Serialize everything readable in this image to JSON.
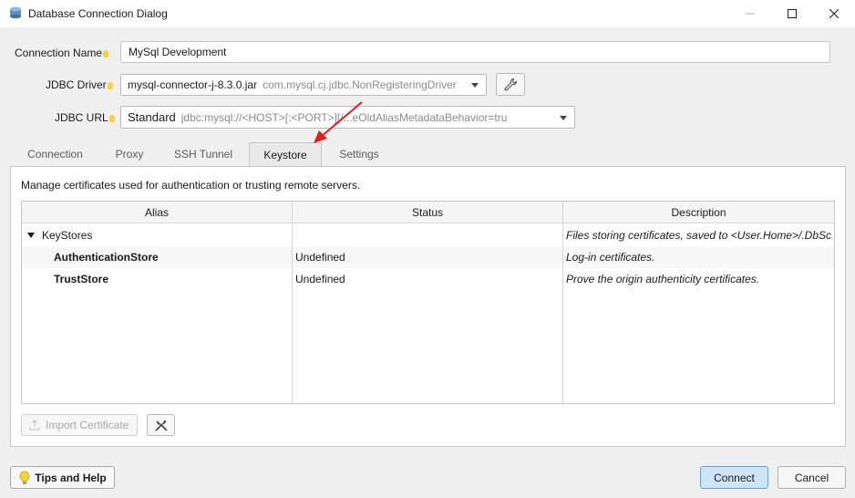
{
  "window": {
    "title": "Database Connection Dialog"
  },
  "form": {
    "connection_name_label": "Connection Name",
    "connection_name_value": "MySql Development",
    "jdbc_driver_label": "JDBC Driver",
    "jdbc_driver_value": "mysql-connector-j-8.3.0.jar",
    "jdbc_driver_hint": "com.mysql.cj.jdbc.NonRegisteringDriver",
    "jdbc_url_label": "JDBC URL",
    "jdbc_url_value": "Standard",
    "jdbc_url_hint": "jdbc:mysql://<HOST>[:<PORT>][/...eOldAliasMetadataBehavior=tru"
  },
  "tabs": [
    {
      "label": "Connection"
    },
    {
      "label": "Proxy"
    },
    {
      "label": "SSH Tunnel"
    },
    {
      "label": "Keystore",
      "active": true
    },
    {
      "label": "Settings"
    }
  ],
  "keystore": {
    "description": "Manage certificates used for authentication or trusting remote servers.",
    "columns": [
      "Alias",
      "Status",
      "Description"
    ],
    "rows": [
      {
        "alias": "KeyStores",
        "status": "",
        "description": "Files storing certificates, saved to <User.Home>/.DbSc..."
      },
      {
        "alias": "AuthenticationStore",
        "status": "Undefined",
        "description": "Log-in certificates."
      },
      {
        "alias": "TrustStore",
        "status": "Undefined",
        "description": "Prove the origin authenticity certificates."
      }
    ],
    "import_label": "Import Certificate"
  },
  "footer": {
    "tips_label": "Tips and Help",
    "connect_label": "Connect",
    "cancel_label": "Cancel"
  },
  "colors": {
    "accent": "#cde5f7",
    "accent_border": "#6aa3d3",
    "annotation_arrow": "#e02020"
  }
}
